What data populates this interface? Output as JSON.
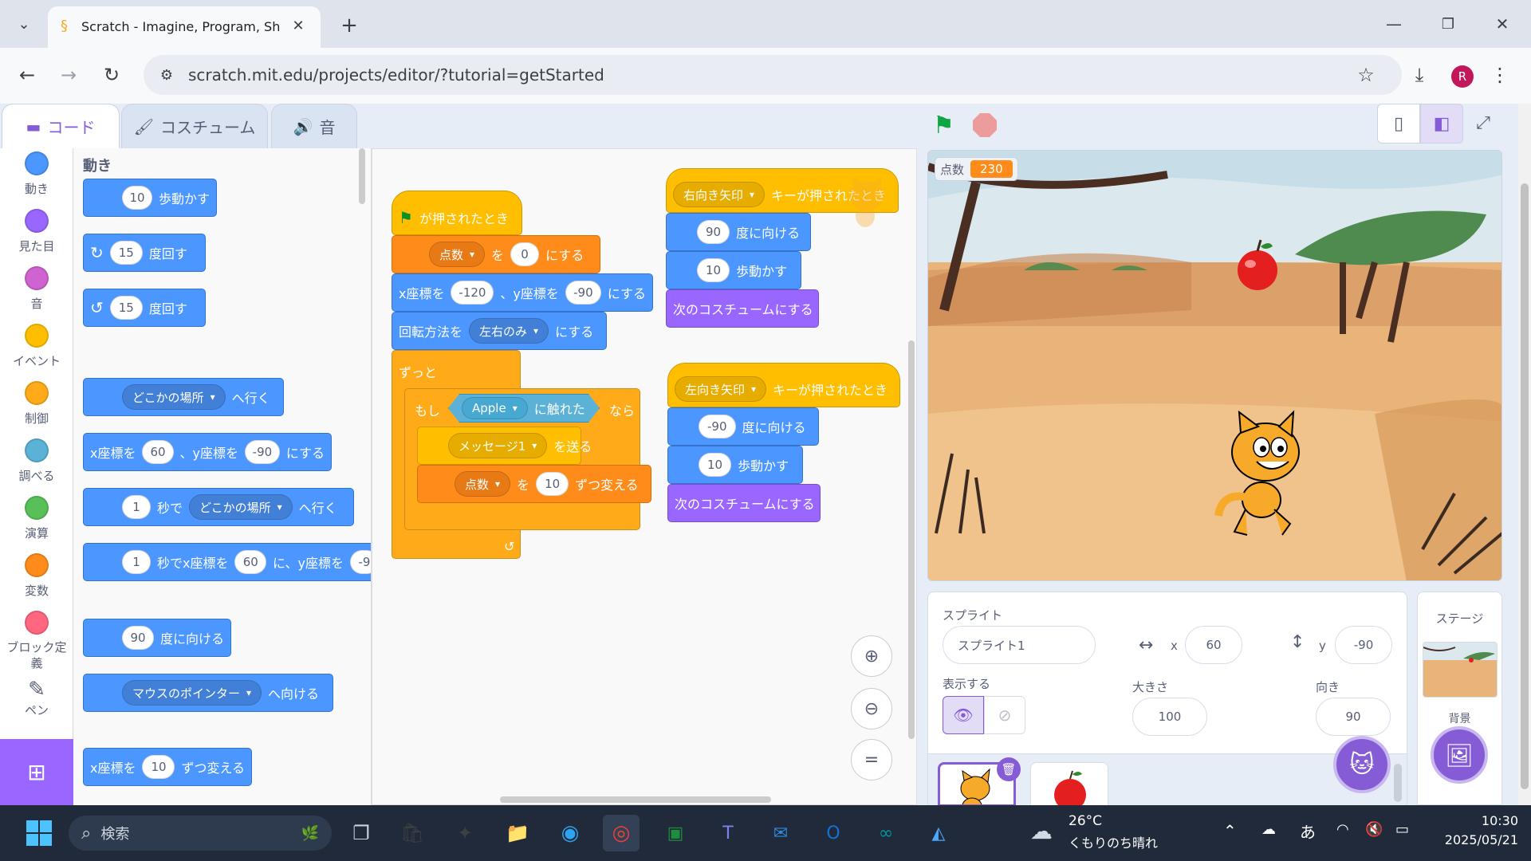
{
  "browser": {
    "tab_title": "Scratch - Imagine, Program, Sha",
    "url": "scratch.mit.edu/projects/editor/?tutorial=getStarted",
    "profile_initial": "R"
  },
  "editor_tabs": {
    "code": "コード",
    "costumes": "コスチューム",
    "sounds": "音"
  },
  "categories": [
    {
      "label": "動き",
      "color": "#4c97ff"
    },
    {
      "label": "見た目",
      "color": "#9966ff"
    },
    {
      "label": "音",
      "color": "#cf63cf"
    },
    {
      "label": "イベント",
      "color": "#ffbf00"
    },
    {
      "label": "制御",
      "color": "#ffab19"
    },
    {
      "label": "調べる",
      "color": "#5cb1d6"
    },
    {
      "label": "演算",
      "color": "#59c059"
    },
    {
      "label": "変数",
      "color": "#ff8c1a"
    },
    {
      "label": "ブロック定義",
      "color": "#ff6680"
    },
    {
      "label": "ペン",
      "color": "#0fbd8c"
    }
  ],
  "palette": {
    "heading": "動き",
    "move_n": "10",
    "move_txt": "歩動かす",
    "turn_r_n": "15",
    "turn_txt": "度回す",
    "turn_l_n": "15",
    "goto_dd": "どこかの場所",
    "goto_txt": "へ行く",
    "gotoxy_x_lbl": "x座標を",
    "gotoxy_x": "60",
    "gotoxy_y_lbl": "、y座標を",
    "gotoxy_y": "-90",
    "gotoxy_end": "にする",
    "glide_n": "1",
    "glide_txt1": "秒で",
    "glide_dd": "どこかの場所",
    "glide_txt2": "へ行く",
    "glidexy_n": "1",
    "glidexy_txt1": "秒でx座標を",
    "glidexy_x": "60",
    "glidexy_txt2": "に、y座標を",
    "glidexy_y": "-9",
    "point_n": "90",
    "point_txt": "度に向ける",
    "towards_dd": "マウスのポインター",
    "towards_txt": "へ向ける",
    "changex_lbl": "x座標を",
    "changex_n": "10",
    "changex_txt": "ずつ変える"
  },
  "script1": {
    "hat": "が押されたとき",
    "setvar_dd": "点数",
    "setvar_wo": "を",
    "setvar_n": "0",
    "setvar_end": "にする",
    "xy_lbl": "x座標を",
    "xy_x": "-120",
    "xy_mid": "、y座標を",
    "xy_y": "-90",
    "xy_end": "にする",
    "rot_lbl": "回転方法を",
    "rot_dd": "左右のみ",
    "rot_end": "にする",
    "forever": "ずっと",
    "if": "もし",
    "touch_dd": "Apple",
    "touch_txt": "に触れた",
    "then": "なら",
    "bcast_dd": "メッセージ1",
    "bcast_txt": "を送る",
    "chg_dd": "点数",
    "chg_wo": "を",
    "chg_n": "10",
    "chg_end": "ずつ変える"
  },
  "script2": {
    "key_dd": "右向き矢印",
    "key_txt": "キーが押されたとき",
    "point_n": "90",
    "point_txt": "度に向ける",
    "move_n": "10",
    "move_txt": "歩動かす",
    "costume": "次のコスチュームにする"
  },
  "script3": {
    "key_dd": "左向き矢印",
    "key_txt": "キーが押されたとき",
    "point_n": "-90",
    "point_txt": "度に向ける",
    "move_n": "10",
    "move_txt": "歩動かす",
    "costume": "次のコスチュームにする"
  },
  "stage": {
    "var_label": "点数",
    "var_value": "230"
  },
  "sprite_info": {
    "sprite_label": "スプライト",
    "sprite_name": "スプライト1",
    "x_label": "x",
    "x": "60",
    "y_label": "y",
    "y": "-90",
    "show_label": "表示する",
    "size_label": "大きさ",
    "size": "100",
    "dir_label": "向き",
    "direction": "90"
  },
  "stage_panel": {
    "title": "ステージ",
    "backdrop_label": "背景"
  },
  "taskbar": {
    "search": "検索",
    "temp": "26°C",
    "weather": "くもりのち晴れ",
    "ime": "あ",
    "time": "10:30",
    "date": "2025/05/21"
  }
}
